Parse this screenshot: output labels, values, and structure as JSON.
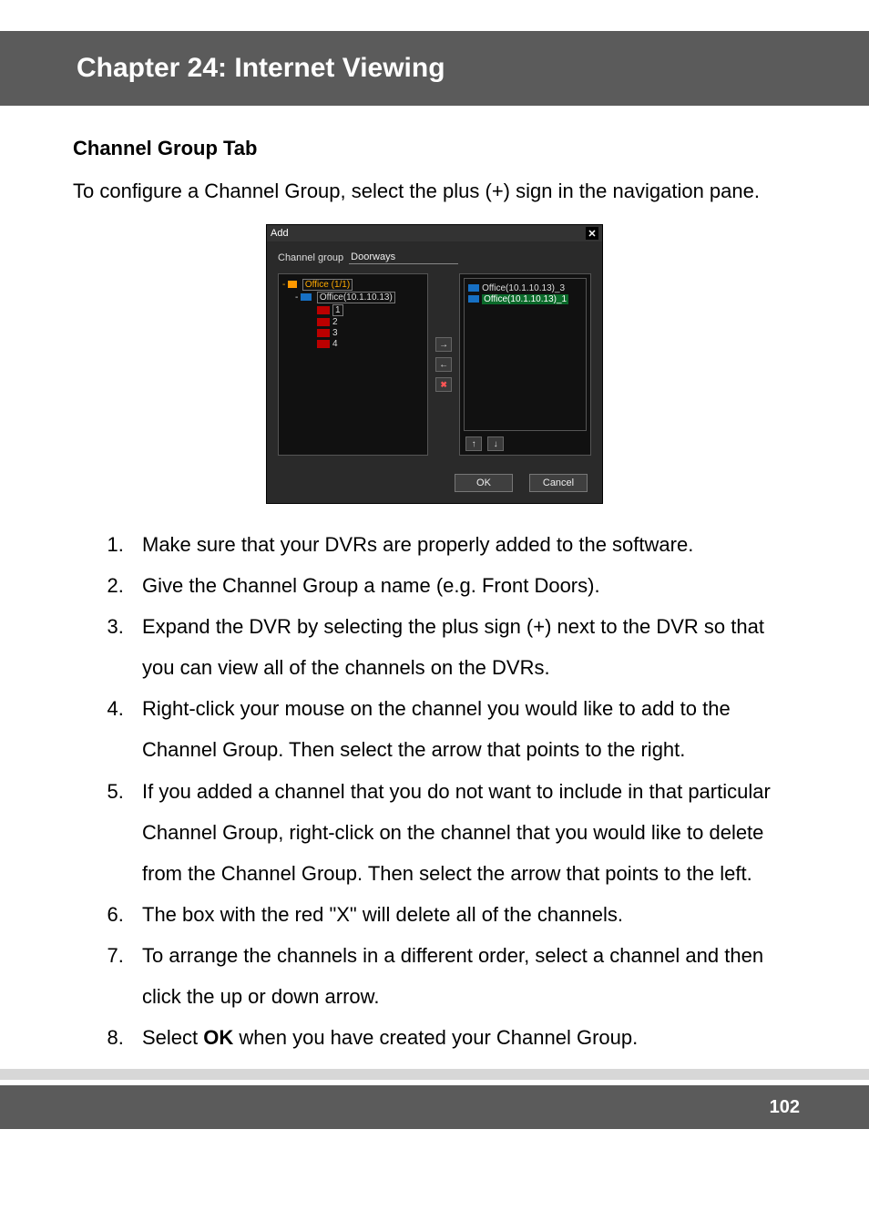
{
  "chapter_title": "Chapter 24: Internet Viewing",
  "section_title": "Channel Group Tab",
  "intro": "To configure a Channel Group, select the plus (+) sign in the navigation pane.",
  "dialog": {
    "title": "Add",
    "close_glyph": "✕",
    "group_label": "Channel group",
    "group_value": "Doorways",
    "tree_root": "Office (1/1)",
    "tree_device": "Office(10.1.10.13)",
    "tree_channels": [
      "1",
      "2",
      "3",
      "4"
    ],
    "right_items": [
      "Office(10.1.10.13)_3",
      "Office(10.1.10.13)_1"
    ],
    "btn_right": "→",
    "btn_left": "←",
    "btn_clear": "✖",
    "btn_up": "↑",
    "btn_down": "↓",
    "ok": "OK",
    "cancel": "Cancel"
  },
  "steps": [
    "Make sure that your DVRs are properly added to the software.",
    "Give the Channel Group a name (e.g. Front Doors).",
    "Expand the DVR by selecting the plus sign (+) next to the DVR so that you can view all of the channels on the DVRs.",
    "Right-click your mouse on the channel you would like to add to the Channel Group. Then select the arrow that points to the right.",
    "If you added a channel that you do not want to include in that particular Channel Group, right-click on the channel that you would like to delete from the Channel Group. Then select the arrow that points to the left.",
    "The box with the red \"X\" will delete all of the channels.",
    "To arrange the channels in a different order, select a channel and then click the up or down arrow.",
    "Select OK when you have created your Channel Group."
  ],
  "step8_prefix": "Select ",
  "step8_bold": "OK",
  "step8_suffix": " when you have created your Channel Group.",
  "page_number": "102"
}
